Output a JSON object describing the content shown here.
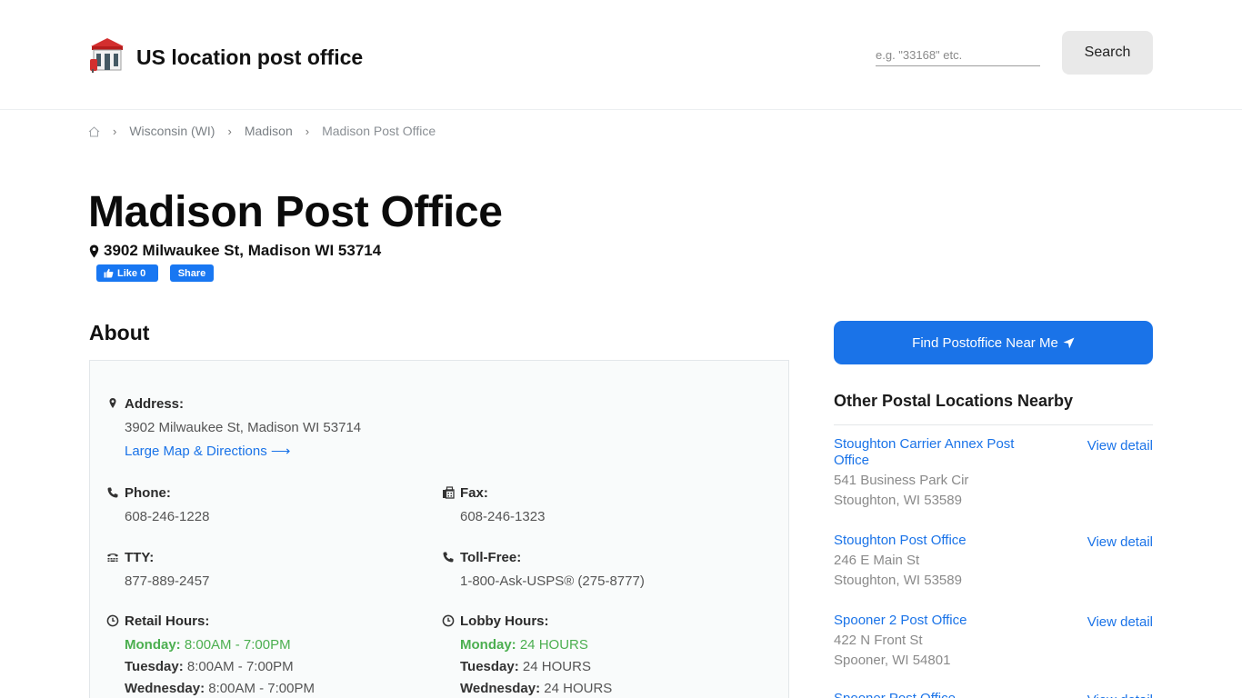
{
  "header": {
    "site_title": "US location post office",
    "search_placeholder": "e.g. \"33168\" etc.",
    "search_button": "Search"
  },
  "breadcrumb": {
    "items": [
      "Wisconsin (WI)",
      "Madison",
      "Madison Post Office"
    ]
  },
  "page": {
    "title": "Madison Post Office",
    "address": "3902 Milwaukee St, Madison WI 53714",
    "fb_like": "Like 0",
    "fb_share": "Share"
  },
  "about": {
    "heading": "About",
    "address_label": "Address:",
    "address_value": "3902 Milwaukee St, Madison WI 53714",
    "map_link": "Large Map & Directions",
    "phone_label": "Phone:",
    "phone_value": "608-246-1228",
    "fax_label": "Fax:",
    "fax_value": "608-246-1323",
    "tty_label": "TTY:",
    "tty_value": "877-889-2457",
    "tollfree_label": "Toll-Free:",
    "tollfree_value": "1-800-Ask-USPS® (275-8777)",
    "retail_label": "Retail Hours:",
    "retail_hours": [
      {
        "day": "Monday:",
        "hours": "8:00AM - 7:00PM"
      },
      {
        "day": "Tuesday:",
        "hours": "8:00AM - 7:00PM"
      },
      {
        "day": "Wednesday:",
        "hours": "8:00AM - 7:00PM"
      }
    ],
    "lobby_label": "Lobby Hours:",
    "lobby_hours": [
      {
        "day": "Monday:",
        "hours": "24 HOURS"
      },
      {
        "day": "Tuesday:",
        "hours": "24 HOURS"
      },
      {
        "day": "Wednesday:",
        "hours": "24 HOURS"
      }
    ]
  },
  "sidebar": {
    "near_button": "Find Postoffice Near Me",
    "nearby_heading": "Other Postal Locations Nearby",
    "view_label": "View detail",
    "nearby": [
      {
        "name": "Stoughton Carrier Annex Post Office",
        "street": "541 Business Park Cir",
        "city": "Stoughton, WI 53589"
      },
      {
        "name": "Stoughton Post Office",
        "street": "246 E Main St",
        "city": "Stoughton, WI 53589"
      },
      {
        "name": "Spooner 2 Post Office",
        "street": "422 N Front St",
        "city": "Spooner, WI 54801"
      },
      {
        "name": "Spooner Post Office",
        "street": "",
        "city": ""
      }
    ]
  },
  "colors": {
    "accent": "#1a73e8",
    "today_green": "#4caf50"
  }
}
